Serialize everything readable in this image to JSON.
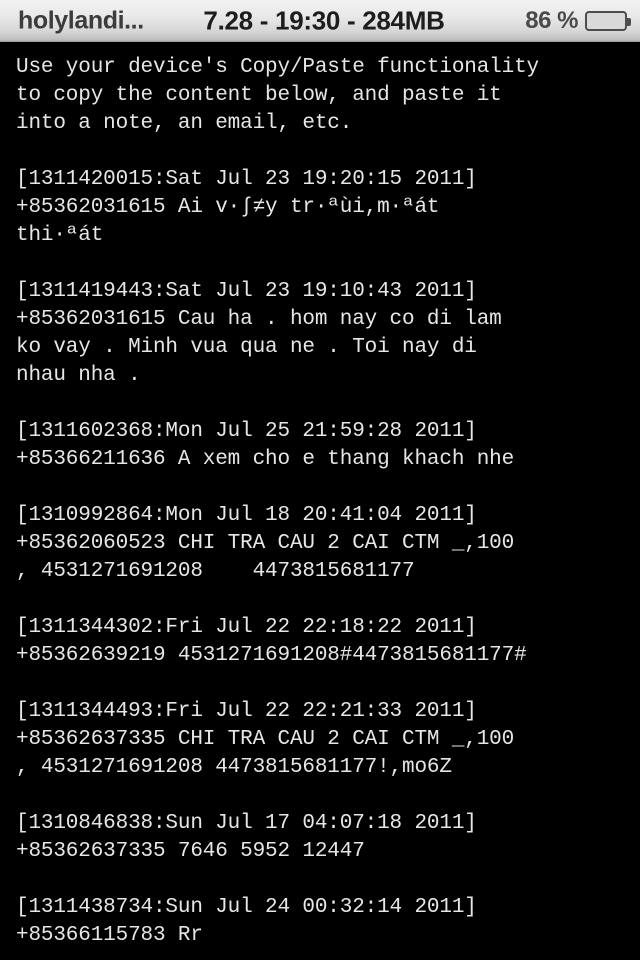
{
  "status_bar": {
    "carrier": "holylandi...",
    "center_info": "7.28 - 19:30 - 284MB",
    "battery_percent": "86 %",
    "battery_level": 86,
    "battery_color": "#6fd321",
    "bar_background": "#e9e9e9",
    "icons": {
      "battery": "battery-icon"
    }
  },
  "main": {
    "text_color": "#e6e6e6",
    "background_color": "#000000",
    "instructions": [
      "Use your device's Copy/Paste functionality",
      "to copy the content below, and paste it",
      "into a note, an email, etc."
    ],
    "messages": [
      {
        "header": "[1311420015:Sat Jul 23 19:20:15 2011]",
        "timestamp_epoch": "1311420015",
        "timestamp_human": "Sat Jul 23 19:20:15 2011",
        "sender": "+85362031615",
        "body_lines": [
          "+85362031615 Ai v·∫≠y tr·ªùi,m·ªát",
          "thi·ªát"
        ]
      },
      {
        "header": "[1311419443:Sat Jul 23 19:10:43 2011]",
        "timestamp_epoch": "1311419443",
        "timestamp_human": "Sat Jul 23 19:10:43 2011",
        "sender": "+85362031615",
        "body_lines": [
          "+85362031615 Cau ha . hom nay co di lam",
          "ko vay . Minh vua qua ne . Toi nay di",
          "nhau nha ."
        ]
      },
      {
        "header": "[1311602368:Mon Jul 25 21:59:28 2011]",
        "timestamp_epoch": "1311602368",
        "timestamp_human": "Mon Jul 25 21:59:28 2011",
        "sender": "+85366211636",
        "body_lines": [
          "+85366211636 A xem cho e thang khach nhe"
        ]
      },
      {
        "header": "[1310992864:Mon Jul 18 20:41:04 2011]",
        "timestamp_epoch": "1310992864",
        "timestamp_human": "Mon Jul 18 20:41:04 2011",
        "sender": "+85362060523",
        "body_lines": [
          "+85362060523 CHI TRA CAU 2 CAI CTM _,100",
          ", 4531271691208    4473815681177"
        ]
      },
      {
        "header": "[1311344302:Fri Jul 22 22:18:22 2011]",
        "timestamp_epoch": "1311344302",
        "timestamp_human": "Fri Jul 22 22:18:22 2011",
        "sender": "+85362639219",
        "body_lines": [
          "+85362639219 4531271691208#4473815681177#"
        ]
      },
      {
        "header": "[1311344493:Fri Jul 22 22:21:33 2011]",
        "timestamp_epoch": "1311344493",
        "timestamp_human": "Fri Jul 22 22:21:33 2011",
        "sender": "+85362637335",
        "body_lines": [
          "+85362637335 CHI TRA CAU 2 CAI CTM _,100",
          ", 4531271691208 4473815681177!,mo6Z"
        ]
      },
      {
        "header": "[1310846838:Sun Jul 17 04:07:18 2011]",
        "timestamp_epoch": "1310846838",
        "timestamp_human": "Sun Jul 17 04:07:18 2011",
        "sender": "+85362637335",
        "body_lines": [
          "+85362637335 7646 5952 12447"
        ]
      },
      {
        "header": "[1311438734:Sun Jul 24 00:32:14 2011]",
        "timestamp_epoch": "1311438734",
        "timestamp_human": "Sun Jul 24 00:32:14 2011",
        "sender": "+85366115783",
        "body_lines": [
          "+85366115783 Rr"
        ]
      }
    ]
  }
}
